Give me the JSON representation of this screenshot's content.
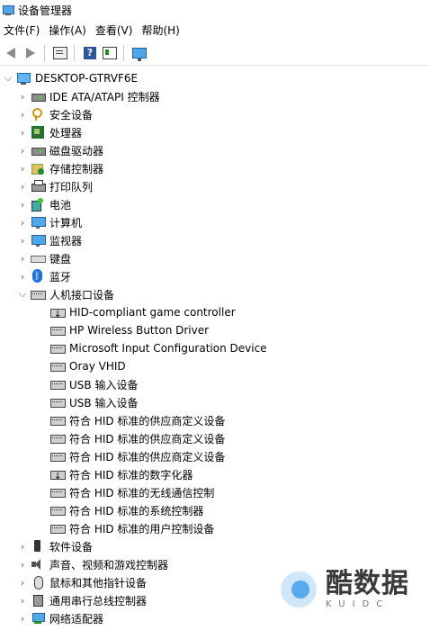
{
  "window": {
    "title": "设备管理器",
    "icon": "device-manager-icon"
  },
  "menu": [
    "文件(F)",
    "操作(A)",
    "查看(V)",
    "帮助(H)"
  ],
  "toolbar": {
    "buttons": [
      {
        "name": "back-button",
        "icon": "arrow-left-icon"
      },
      {
        "name": "forward-button",
        "icon": "arrow-right-icon"
      },
      {
        "name": "properties-button",
        "icon": "properties-icon"
      },
      {
        "name": "help-button",
        "icon": "help-icon",
        "label": "?"
      },
      {
        "name": "view-button",
        "icon": "view-icon"
      },
      {
        "name": "scan-hardware-button",
        "icon": "monitor-scan-icon"
      }
    ]
  },
  "tree": {
    "root": "DESKTOP-GTRVF6E",
    "categories": [
      "IDE ATA/ATAPI 控制器",
      "安全设备",
      "处理器",
      "磁盘驱动器",
      "存储控制器",
      "打印队列",
      "电池",
      "计算机",
      "监视器",
      "键盘",
      "蓝牙",
      "人机接口设备",
      "软件设备",
      "声音、视频和游戏控制器",
      "鼠标和其他指针设备",
      "通用串行总线控制器",
      "网络适配器"
    ],
    "hid_children": [
      "HID-compliant game controller",
      "HP Wireless Button Driver",
      "Microsoft Input Configuration Device",
      "Oray VHID",
      "USB 输入设备",
      "USB 输入设备",
      "符合 HID 标准的供应商定义设备",
      "符合 HID 标准的供应商定义设备",
      "符合 HID 标准的供应商定义设备",
      "符合 HID 标准的数字化器",
      "符合 HID 标准的无线通信控制",
      "符合 HID 标准的系统控制器",
      "符合 HID 标准的用户控制设备"
    ]
  },
  "watermark": {
    "main": "酷数据",
    "sub": "KUIDC"
  }
}
